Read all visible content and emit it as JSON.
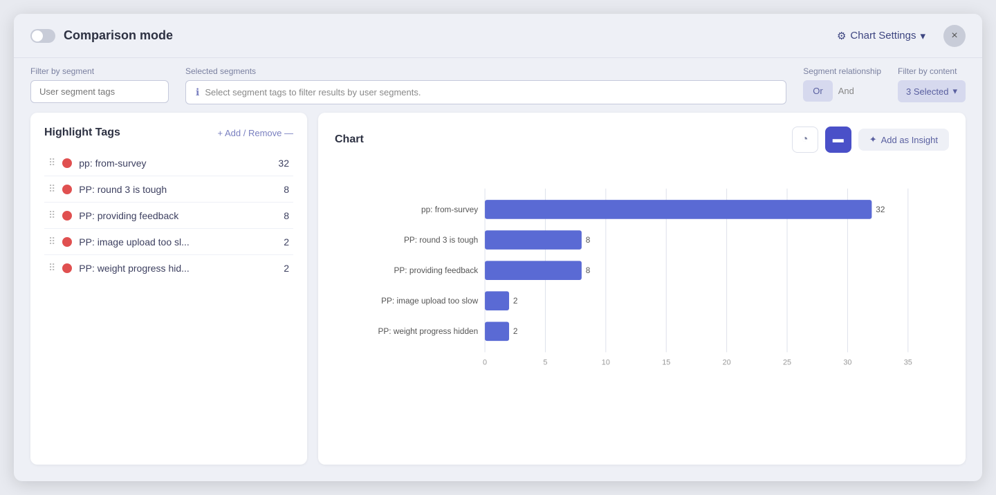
{
  "header": {
    "mode_label": "Comparison mode",
    "chart_settings_label": "Chart Settings",
    "close_label": "×"
  },
  "filter_bar": {
    "filter_by_segment_label": "Filter by segment",
    "segment_input_placeholder": "User segment tags",
    "selected_segments_label": "Selected segments",
    "selected_info_text": "Select segment tags to filter results by user segments.",
    "segment_relationship_label": "Segment relationship",
    "or_label": "Or",
    "and_label": "And",
    "filter_by_content_label": "Filter by content",
    "selected_label": "3 Selected"
  },
  "left_panel": {
    "title": "Highlight Tags",
    "add_remove_label": "+ Add / Remove —",
    "tags": [
      {
        "name": "pp: from-survey",
        "count": 32
      },
      {
        "name": "PP: round 3 is tough",
        "count": 8
      },
      {
        "name": "PP: providing feedback",
        "count": 8
      },
      {
        "name": "PP: image upload too sl...",
        "count": 2
      },
      {
        "name": "PP: weight progress hid...",
        "count": 2
      }
    ]
  },
  "chart": {
    "title": "Chart",
    "add_insight_label": "Add as Insight",
    "bars": [
      {
        "label": "pp: from-survey",
        "value": 32,
        "max": 35
      },
      {
        "label": "PP: round 3 is tough",
        "value": 8,
        "max": 35
      },
      {
        "label": "PP: providing feedback",
        "value": 8,
        "max": 35
      },
      {
        "label": "PP: image upload too slow",
        "value": 2,
        "max": 35
      },
      {
        "label": "PP: weight progress hidden",
        "value": 2,
        "max": 35
      }
    ],
    "x_ticks": [
      0,
      5,
      10,
      15,
      20,
      25,
      30,
      35
    ],
    "bar_color": "#5a6ad4",
    "bar_color_light": "#8892e0"
  }
}
